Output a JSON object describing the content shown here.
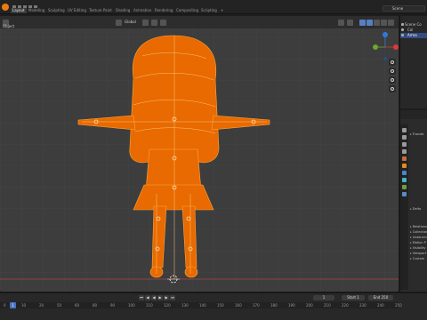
{
  "app": "Blender",
  "workspaces": [
    {
      "label": "Layout",
      "active": true
    },
    {
      "label": "Modeling"
    },
    {
      "label": "Sculpting"
    },
    {
      "label": "UV Editing"
    },
    {
      "label": "Texture Paint"
    },
    {
      "label": "Shading"
    },
    {
      "label": "Animation"
    },
    {
      "label": "Rendering"
    },
    {
      "label": "Compositing"
    },
    {
      "label": "Scripting"
    }
  ],
  "add_tab": "+",
  "scene": {
    "name": "Scene"
  },
  "view_layer": "",
  "viewport": {
    "mode": "Object",
    "transform_orientation": "Global",
    "object_label": "Object",
    "accent_color": "#ff8c1a",
    "selected_color": "#e66100",
    "background": "#3d3d3d"
  },
  "outliner": {
    "rows": [
      {
        "label": "Scene Co",
        "selected": false
      },
      {
        "label": "Col",
        "selected": false
      },
      {
        "label": "Arma",
        "selected": true
      }
    ]
  },
  "properties": {
    "header": "",
    "rows": [
      {
        "label": "Transfo"
      },
      {
        "label": "Delta"
      },
      {
        "label": "Relations"
      },
      {
        "label": "Collections"
      },
      {
        "label": "Instancing"
      },
      {
        "label": "Motion P"
      },
      {
        "label": "Visibility"
      },
      {
        "label": "Viewport"
      },
      {
        "label": "Custom"
      }
    ]
  },
  "timeline": {
    "current_frame": "1",
    "start_label": "Start",
    "start": "1",
    "end_label": "End",
    "end": "250",
    "ticks": [
      "0",
      "10",
      "20",
      "50",
      "60",
      "80",
      "90",
      "100",
      "110",
      "120",
      "130",
      "140",
      "150",
      "160",
      "170",
      "180",
      "190",
      "200",
      "210",
      "220",
      "230",
      "240",
      "250"
    ]
  }
}
